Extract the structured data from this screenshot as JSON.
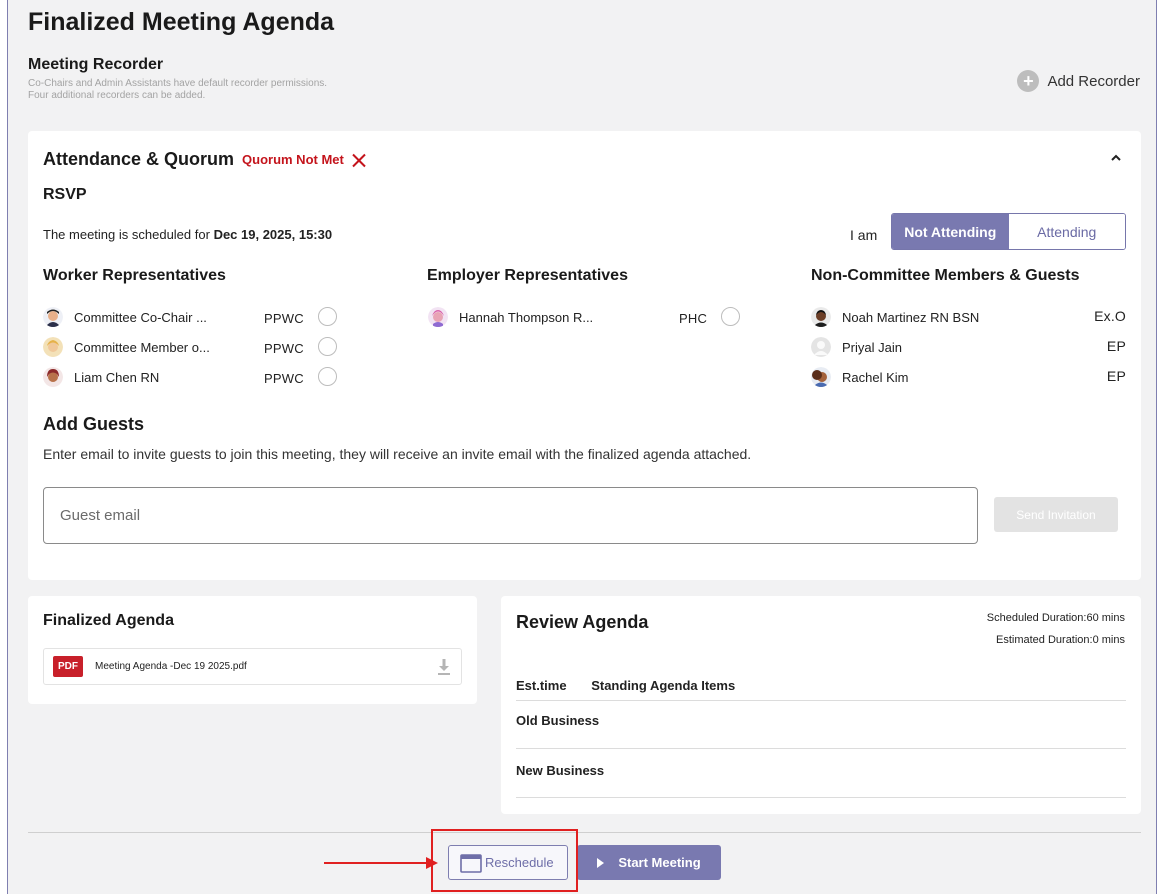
{
  "page": {
    "title": "Finalized Meeting Agenda"
  },
  "recorder": {
    "title": "Meeting Recorder",
    "note": "Co-Chairs and Admin Assistants have default recorder permissions. Four additional recorders can be added.",
    "add_label": "Add Recorder",
    "add_icon": "plus-circle-icon"
  },
  "attendance": {
    "title": "Attendance & Quorum",
    "quorum_status": "Quorum Not Met",
    "quorum_color": "#c4141c",
    "rsvp_label": "RSVP",
    "schedule_prefix": "The meeting is scheduled for",
    "schedule_datetime": "Dec 19, 2025, 15:30",
    "i_am_label": "I am",
    "options": [
      "Not Attending",
      "Attending"
    ],
    "selected_option": "Not Attending",
    "accent_color": "#7979b0"
  },
  "groups": {
    "worker": {
      "title": "Worker Representatives",
      "members": [
        {
          "name": "Committee Co-Chair ...",
          "org": "PPWC"
        },
        {
          "name": "Committee Member o...",
          "org": "PPWC"
        },
        {
          "name": "Liam Chen RN",
          "org": "PPWC"
        }
      ]
    },
    "employer": {
      "title": "Employer Representatives",
      "members": [
        {
          "name": "Hannah Thompson R...",
          "org": "PHC"
        }
      ]
    },
    "guests": {
      "title": "Non-Committee Members & Guests",
      "members": [
        {
          "name": "Noah Martinez RN BSN",
          "role": "Ex.O"
        },
        {
          "name": "Priyal Jain",
          "role": "EP"
        },
        {
          "name": "Rachel Kim",
          "role": "EP"
        }
      ]
    }
  },
  "add_guests": {
    "title": "Add Guests",
    "description": "Enter email to invite guests to join this meeting, they will receive an invite email with the finalized agenda attached.",
    "input_placeholder": "Guest email",
    "input_value": "",
    "send_label": "Send Invitation"
  },
  "finalized_agenda": {
    "title": "Finalized Agenda",
    "file_badge": "PDF",
    "file_name": "Meeting Agenda -Dec 19 2025.pdf"
  },
  "review_agenda": {
    "title": "Review Agenda",
    "scheduled_duration": "Scheduled Duration:60 mins",
    "estimated_duration": "Estimated Duration:0 mins",
    "col_time": "Est.time",
    "col_items": "Standing Agenda Items",
    "rows": [
      "Old Business",
      "New Business"
    ]
  },
  "footer": {
    "reschedule_label": "Reschedule",
    "start_label": "Start Meeting"
  }
}
